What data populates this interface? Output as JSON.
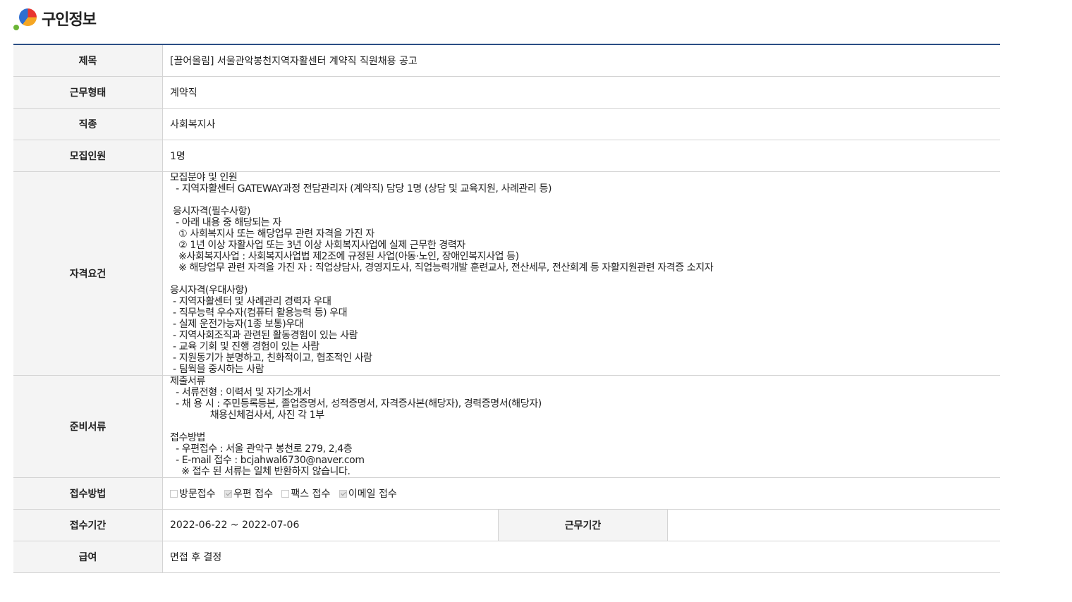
{
  "header": {
    "title": "구인정보"
  },
  "rows": {
    "title": {
      "label": "제목",
      "value": "[끌어올림] 서울관악봉천지역자활센터 계약직 직원채용 공고"
    },
    "employment_type": {
      "label": "근무형태",
      "value": "계약직"
    },
    "job_category": {
      "label": "직종",
      "value": "사회복지사"
    },
    "headcount": {
      "label": "모집인원",
      "value": "1명"
    },
    "qualifications": {
      "label": "자격요건",
      "value": "모집분야 및 인원\n  - 지역자활센터 GATEWAY과정 전담관리자 (계약직) 담당 1명 (상담 및 교육지원, 사례관리 등)\n\n 응시자격(필수사항)\n  - 아래 내용 중 해당되는 자\n   ① 사회복지사 또는 해당업무 관련 자격을 가진 자\n   ② 1년 이상 자활사업 또는 3년 이상 사회복지사업에 실제 근무한 경력자\n   ※사회복지사업 : 사회복지사업법 제2조에 규정된 사업(아동·노인, 장애인복지사업 등)\n   ※ 해당업무 관련 자격을 가진 자 : 직업상담사, 경영지도사, 직업능력개발 훈련교사, 전산세무, 전산회계 등 자활지원관련 자격증 소지자\n\n응시자격(우대사항)\n - 지역자활센터 및 사례관리 경력자 우대\n - 직무능력 우수자(컴퓨터 활용능력 등) 우대\n - 실제 운전가능자(1종 보통)우대\n - 지역사회조직과 관련된 활동경험이 있는 사람\n - 교육 기회 및 진행 경험이 있는 사람\n - 지원동기가 분명하고, 친화적이고, 협조적인 사람\n - 팀웍을 중시하는 사람"
    },
    "documents": {
      "label": "준비서류",
      "value": "제출서류\n  - 서류전형 : 이력서 및 자기소개서\n  - 채 용 시 : 주민등록등본, 졸업증명서, 성적증명서, 자격증사본(해당자), 경력증명서(해당자)\n              채용신체검사서, 사진 각 1부\n\n접수방법\n  - 우편접수 : 서울 관악구 봉천로 279, 2,4층\n  - E-mail 접수 : bcjahwal6730@naver.com\n    ※ 접수 된 서류는 일체 반환하지 않습니다."
    },
    "method": {
      "label": "접수방법",
      "options": [
        {
          "label": "방문접수",
          "checked": false
        },
        {
          "label": "우편 접수",
          "checked": true
        },
        {
          "label": "팩스 접수",
          "checked": false
        },
        {
          "label": "이메일 접수",
          "checked": true
        }
      ]
    },
    "period": {
      "label": "접수기간",
      "value": "2022-06-22 ~ 2022-07-06",
      "work_label": "근무기간",
      "work_value": ""
    },
    "salary": {
      "label": "급여",
      "value": "면접 후 결정"
    }
  }
}
